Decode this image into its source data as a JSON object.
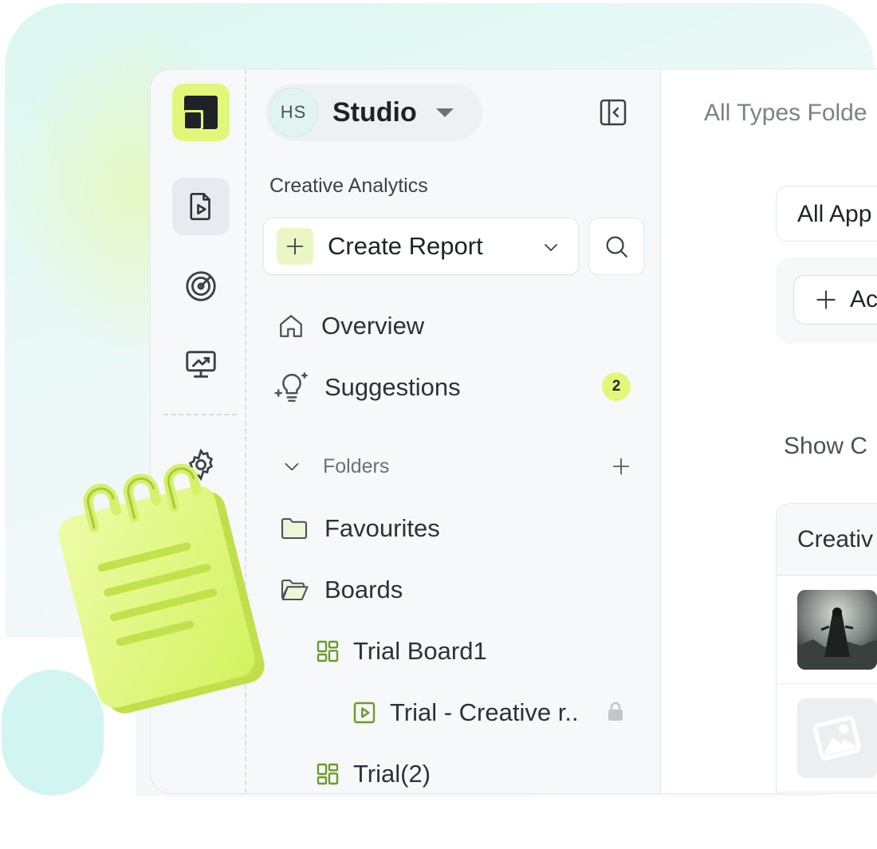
{
  "workspace": {
    "initials": "HS",
    "name": "Studio"
  },
  "sidebar": {
    "section_label": "Creative Analytics",
    "create_label": "Create Report",
    "nav": [
      {
        "label": "Overview",
        "icon": "home-icon"
      },
      {
        "label": "Suggestions",
        "icon": "lightbulb-sparkle-icon",
        "badge": "2"
      }
    ],
    "folders_label": "Folders",
    "tree": [
      {
        "label": "Favourites",
        "icon": "folder-icon"
      },
      {
        "label": "Boards",
        "icon": "folder-open-icon"
      },
      {
        "label": "Trial Board1",
        "icon": "board-grid-icon"
      },
      {
        "label": "Trial - Creative r..",
        "icon": "play-square-icon",
        "locked": true
      },
      {
        "label": "Trial(2)",
        "icon": "board-grid-icon"
      }
    ]
  },
  "main": {
    "title": "All Types Folde",
    "app_select": "All App",
    "add_label": "Ac",
    "show_text": "Show C",
    "table_header": "Creativ"
  },
  "colors": {
    "accent": "#e2f77a",
    "accent_icon": "#6a9b2a",
    "text": "#1f2328",
    "muted": "#6b7178"
  }
}
